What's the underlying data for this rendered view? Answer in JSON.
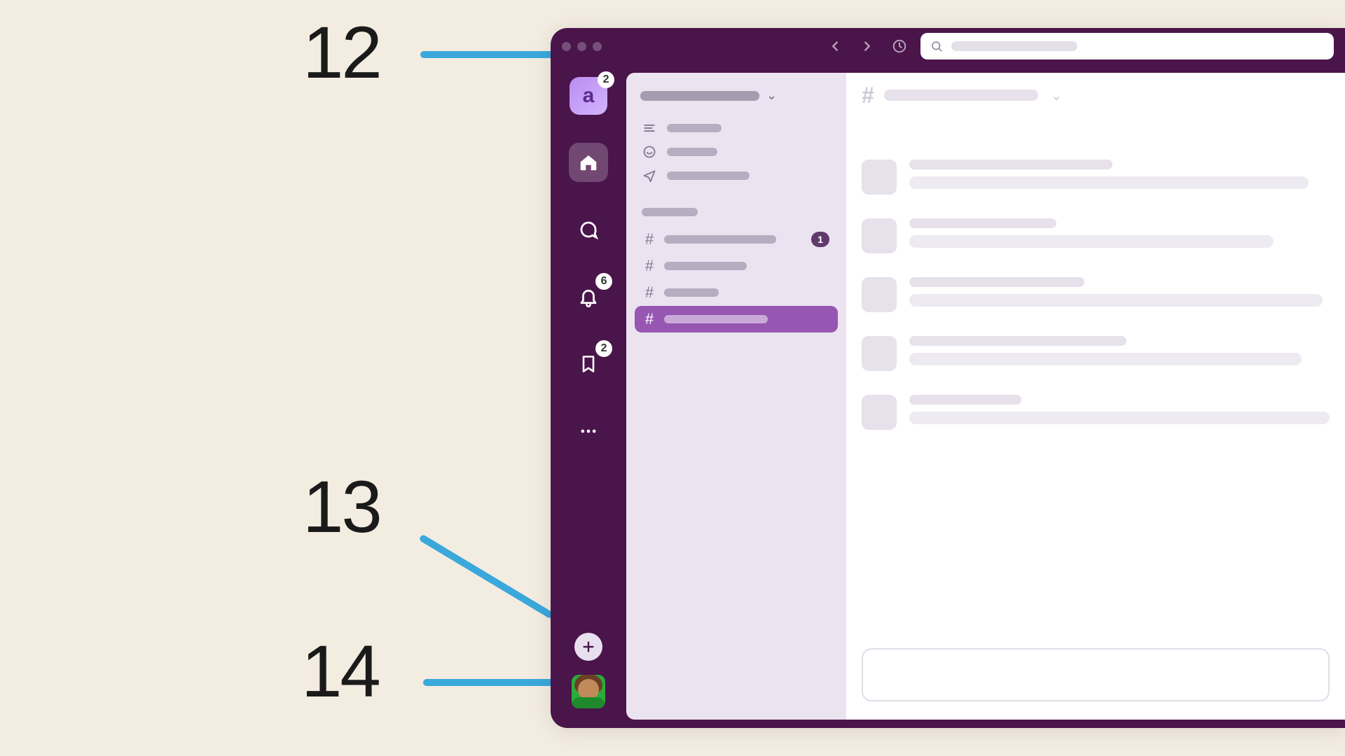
{
  "callouts": [
    {
      "num": "12",
      "target": "search-bar"
    },
    {
      "num": "13",
      "target": "add-button"
    },
    {
      "num": "14",
      "target": "profile-avatar"
    }
  ],
  "colors": {
    "app_frame": "#4a154b",
    "accent_line": "#3aa8db",
    "background": "#f3ece1",
    "active_channel": "#9656b1"
  },
  "topbar": {
    "history_back_icon": "chevron-left",
    "history_forward_icon": "chevron-right",
    "clock_icon": "clock",
    "search_icon": "magnifier",
    "search_value": ""
  },
  "rail": {
    "workspace_letter": "a",
    "workspace_badge": "2",
    "items": [
      {
        "name": "home",
        "icon": "home-icon",
        "active": true,
        "badge": null
      },
      {
        "name": "dms",
        "icon": "dm-icon",
        "active": false,
        "badge": null
      },
      {
        "name": "activity",
        "icon": "bell-icon",
        "active": false,
        "badge": "6"
      },
      {
        "name": "later",
        "icon": "bookmark-icon",
        "active": false,
        "badge": "2"
      },
      {
        "name": "more",
        "icon": "more-icon",
        "active": false,
        "badge": null
      }
    ],
    "add_button_icon": "plus",
    "avatar_status": "active"
  },
  "sidebar": {
    "nav": [
      {
        "icon": "lines-icon"
      },
      {
        "icon": "thread-icon"
      },
      {
        "icon": "send-icon"
      }
    ],
    "channels": [
      {
        "unread_badge": "1",
        "active": false
      },
      {
        "unread_badge": null,
        "active": false
      },
      {
        "unread_badge": null,
        "active": false
      },
      {
        "unread_badge": null,
        "active": true
      }
    ]
  },
  "main": {
    "messages_count": 5
  }
}
